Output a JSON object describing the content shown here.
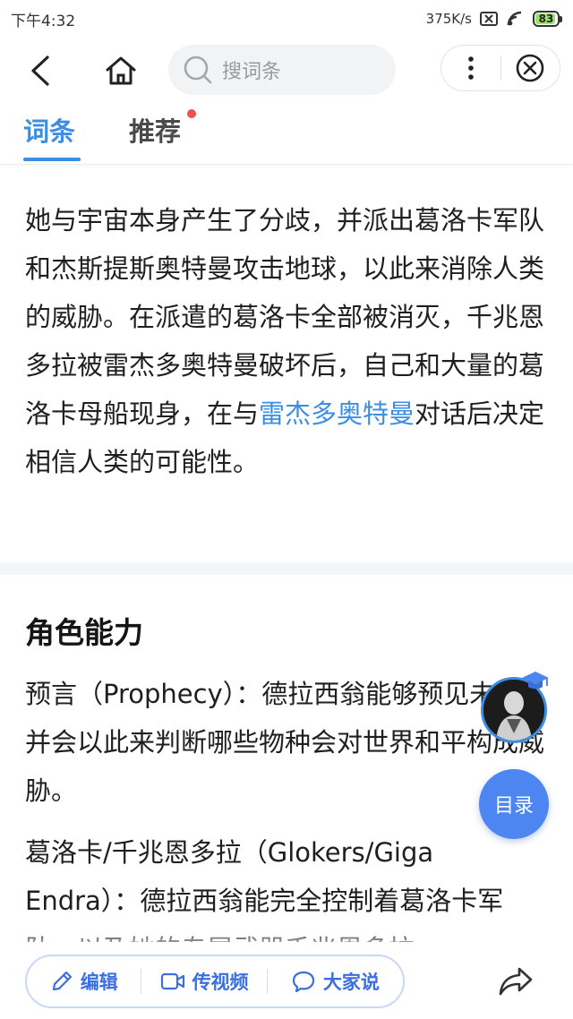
{
  "status_bar": {
    "time": "下午4:32",
    "net_speed": "375K/s",
    "battery_level": "83",
    "battery_fraction": 0.83
  },
  "nav": {
    "search_placeholder": "搜词条",
    "icons": [
      "back-icon",
      "home-icon",
      "search-icon",
      "more-icon",
      "close-icon"
    ]
  },
  "tabs": {
    "entry": "词条",
    "recommend": "推荐",
    "active": "entry",
    "colors": {
      "active": "#3b8ee3",
      "badge": "#f0514b"
    }
  },
  "content": {
    "paragraph1_before_link": "她与宇宙本身产生了分歧，并派出葛洛卡军队和杰斯提斯奥特曼攻击地球，以此来消除人类的威胁。在派遣的葛洛卡全部被消灭，千兆恩多拉被雷杰多奥特曼破坏后，自己和大量的葛洛卡母船现身，在与",
    "paragraph1_link": "雷杰多奥特曼",
    "paragraph1_after_link": "对话后决定相信人类的可能性。",
    "section_title": "角色能力",
    "paragraph2": "预言（Prophecy）：德拉西翁能够预见未来，并会以此来判断哪些物种会对世界和平构成威胁。",
    "paragraph3": "葛洛卡/千兆恩多拉（Glokers/Giga Endra）：德拉西翁能完全控制着葛洛卡军队，以及她的专属武器千兆恩多拉。"
  },
  "floating": {
    "toc_label": "目录",
    "toc_color": "#4d86f0"
  },
  "bottom_bar": {
    "edit_label": "编辑",
    "video_label": "传视频",
    "talk_label": "大家说",
    "icons": [
      "pencil-icon",
      "video-icon",
      "chat-icon",
      "share-icon"
    ]
  }
}
